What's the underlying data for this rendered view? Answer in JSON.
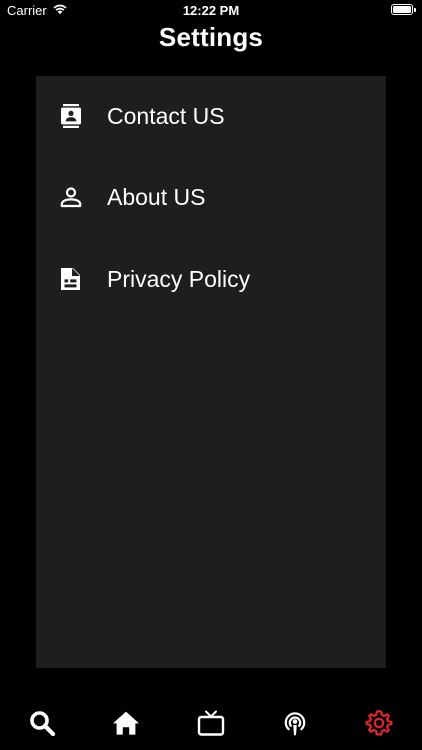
{
  "status_bar": {
    "carrier": "Carrier",
    "time": "12:22 PM",
    "wifi_icon": "wifi-icon",
    "battery_level": 1.0
  },
  "header": {
    "title": "Settings"
  },
  "menu": {
    "items": [
      {
        "label": "Contact US",
        "icon": "contact-card-icon"
      },
      {
        "label": "About US",
        "icon": "person-icon"
      },
      {
        "label": "Privacy Policy",
        "icon": "document-icon"
      }
    ]
  },
  "tab_bar": {
    "tabs": [
      {
        "icon": "search-icon",
        "active": false
      },
      {
        "icon": "home-icon",
        "active": false
      },
      {
        "icon": "tv-icon",
        "active": false
      },
      {
        "icon": "podcast-icon",
        "active": false
      },
      {
        "icon": "gear-icon",
        "active": true
      }
    ],
    "active_color": "#e0262b",
    "inactive_color": "#ffffff"
  },
  "colors": {
    "background": "#000000",
    "panel": "#1e1e1e",
    "text": "#ffffff"
  }
}
